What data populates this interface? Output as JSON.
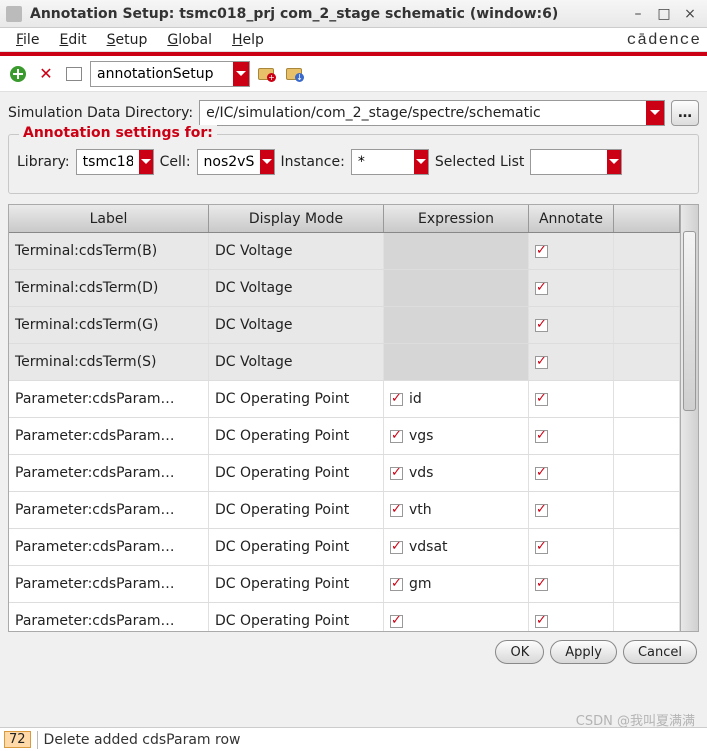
{
  "window": {
    "title": "Annotation Setup: tsmc018_prj com_2_stage schematic (window:6)"
  },
  "brand": "cādence",
  "menu": {
    "file": "File",
    "edit": "Edit",
    "setup": "Setup",
    "global": "Global",
    "help": "Help"
  },
  "toolbarCombo": "annotationSetup",
  "simDir": {
    "label": "Simulation Data Directory:",
    "value": "e/IC/simulation/com_2_stage/spectre/schematic"
  },
  "fieldset": {
    "legend": "Annotation settings for:",
    "libraryLabel": "Library:",
    "libraryValue": "tsmc18",
    "cellLabel": "Cell:",
    "cellValue": "nos2vS",
    "instanceLabel": "Instance:",
    "instanceValue": "*",
    "selectedListLabel": "Selected List",
    "selectedListValue": ""
  },
  "columns": {
    "label": "Label",
    "mode": "Display Mode",
    "expr": "Expression",
    "ann": "Annotate"
  },
  "rows": [
    {
      "kind": "term",
      "label": "Terminal:cdsTerm(B)",
      "mode": "DC Voltage",
      "expr": "",
      "exprChk": false,
      "ann": true
    },
    {
      "kind": "term",
      "label": "Terminal:cdsTerm(D)",
      "mode": "DC Voltage",
      "expr": "",
      "exprChk": false,
      "ann": true
    },
    {
      "kind": "term",
      "label": "Terminal:cdsTerm(G)",
      "mode": "DC Voltage",
      "expr": "",
      "exprChk": false,
      "ann": true
    },
    {
      "kind": "term",
      "label": "Terminal:cdsTerm(S)",
      "mode": "DC Voltage",
      "expr": "",
      "exprChk": false,
      "ann": true
    },
    {
      "kind": "param",
      "label": "Parameter:cdsParam…",
      "mode": "DC Operating Point",
      "expr": "id",
      "exprChk": true,
      "ann": true
    },
    {
      "kind": "param",
      "label": "Parameter:cdsParam…",
      "mode": "DC Operating Point",
      "expr": "vgs",
      "exprChk": true,
      "ann": true
    },
    {
      "kind": "param",
      "label": "Parameter:cdsParam…",
      "mode": "DC Operating Point",
      "expr": "vds",
      "exprChk": true,
      "ann": true
    },
    {
      "kind": "param",
      "label": "Parameter:cdsParam…",
      "mode": "DC Operating Point",
      "expr": "vth",
      "exprChk": true,
      "ann": true
    },
    {
      "kind": "param",
      "label": "Parameter:cdsParam…",
      "mode": "DC Operating Point",
      "expr": "vdsat",
      "exprChk": true,
      "ann": true
    },
    {
      "kind": "param",
      "label": "Parameter:cdsParam…",
      "mode": "DC Operating Point",
      "expr": "gm",
      "exprChk": true,
      "ann": true
    },
    {
      "kind": "param",
      "label": "Parameter:cdsParam…",
      "mode": "DC Operating Point",
      "expr": "",
      "exprChk": true,
      "ann": true
    }
  ],
  "buttons": {
    "ok": "OK",
    "apply": "Apply",
    "cancel": "Cancel"
  },
  "status": {
    "num": "72",
    "text": "Delete added cdsParam row"
  },
  "watermark": "CSDN @我叫夏满满"
}
